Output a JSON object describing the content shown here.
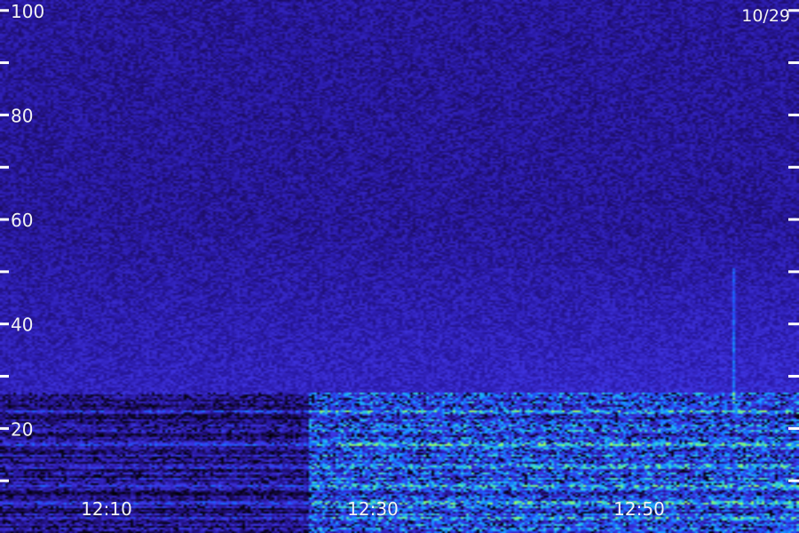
{
  "chart_data": {
    "type": "heatmap",
    "title": "",
    "date_label": "10/29",
    "xlabel": "",
    "ylabel": "",
    "xlim": [
      "12:02",
      "12:62"
    ],
    "ylim": [
      0,
      102
    ],
    "x_ticks": [
      "12:10",
      "12:30",
      "12:50"
    ],
    "y_ticks": [
      20,
      40,
      60,
      80,
      100
    ],
    "grid": false,
    "legend": "none",
    "colormap": [
      "#000000",
      "#1a0a55",
      "#2a1aa8",
      "#3f33e0",
      "#1a5cff",
      "#19a8ff",
      "#3ee0c8",
      "#9cff5a"
    ],
    "features": {
      "background_level": 0.22,
      "band_edge_y": 27,
      "bright_bands_y": [
        23.5,
        17,
        13,
        9,
        6,
        3
      ],
      "vertical_streak_x": "12:57",
      "activity_rises_after": "12:25"
    }
  }
}
